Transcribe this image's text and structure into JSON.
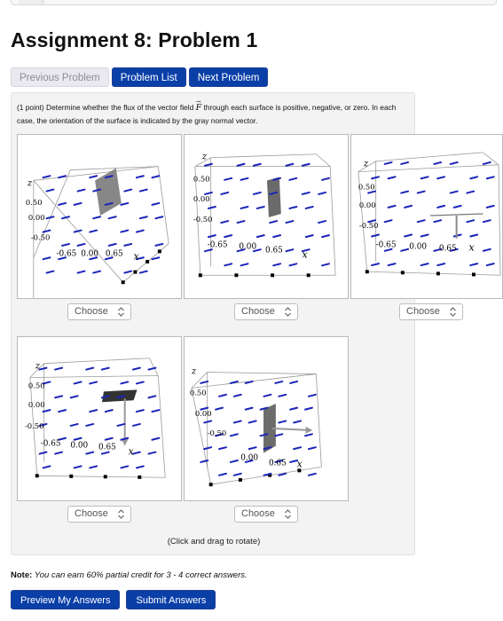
{
  "page": {
    "title": "Assignment 8: Problem 1"
  },
  "nav": {
    "previous": "Previous Problem",
    "list": "Problem List",
    "next": "Next Problem"
  },
  "problem": {
    "prompt_before": "(1 point) Determine whether the flux of the vector field ",
    "field_symbol": "F",
    "prompt_after": " through each surface is positive, negative, or zero. In each case, the orientation of the surface is indicated by the gray normal vector.",
    "caption": "(Click and drag to rotate)",
    "select_value": "Choose",
    "plots": [
      {
        "z_label": "z",
        "x_label": "x",
        "ticks": [
          "0.50",
          "0.00",
          "-0.50",
          "-0.5",
          "0.0",
          "-0.65",
          "0.00",
          "0.65"
        ]
      },
      {
        "z_label": "z",
        "x_label": "x",
        "ticks": [
          "0.50",
          "0.00",
          "-0.50",
          "-0.65",
          "0.00",
          "0.65"
        ]
      },
      {
        "z_label": "z",
        "x_label": "x",
        "ticks": [
          "0.50",
          "0.00",
          "-0.50",
          "-0.65",
          "0.00",
          "0.65"
        ]
      },
      {
        "z_label": "z",
        "x_label": "x",
        "ticks": [
          "0.50",
          "0.00",
          "-0.50",
          "-0.65",
          "0.00",
          "0.65"
        ]
      },
      {
        "z_label": "z",
        "x_label": "x",
        "ticks": [
          "0.50",
          "0.00",
          "-0.50",
          "0.5",
          "-0.5",
          "0.00",
          "0.65"
        ]
      }
    ]
  },
  "note": {
    "label": "Note:",
    "text": "You can earn 60% partial credit for 3 - 4 correct answers."
  },
  "actions": {
    "preview": "Preview My Answers",
    "submit": "Submit Answers"
  },
  "colors": {
    "button": "#0a3fa8",
    "arrows": "#1a23b8",
    "surface": "#6e6e6e"
  }
}
